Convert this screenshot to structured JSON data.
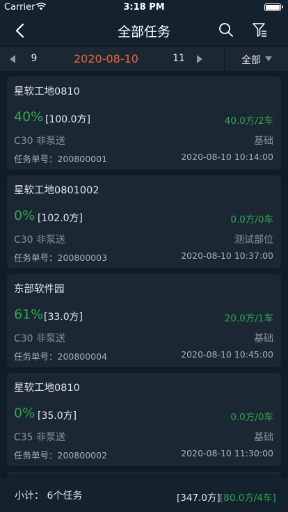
{
  "status_bar": {
    "carrier": "Carrier",
    "time": "3:18 PM"
  },
  "nav": {
    "title": "全部任务",
    "icons": [
      "back-chevron-icon",
      "search-icon",
      "filter-icon"
    ]
  },
  "date_bar": {
    "prev_day": "9",
    "current_date": "2020-08-10",
    "next_day": "11",
    "filter_label": "全部",
    "date_color": "#e8663c"
  },
  "tasks": [
    {
      "site": "星软工地0810",
      "percent": "40%",
      "volume": "[100.0方]",
      "progress": "40.0方/2车",
      "grade": "C30 非泵送",
      "part": "基础",
      "task_no": "任务单号：200800001",
      "time": "2020-08-10 10:14:00"
    },
    {
      "site": "星软工地0801002",
      "percent": "0%",
      "volume": "[102.0方]",
      "progress": "0.0方/0车",
      "grade": "C30 非泵送",
      "part": "测试部位",
      "task_no": "任务单号：200800003",
      "time": "2020-08-10 10:37:00"
    },
    {
      "site": "东部软件园",
      "percent": "61%",
      "volume": "[33.0方]",
      "progress": "20.0方/1车",
      "grade": "C30 非泵送",
      "part": "基础",
      "task_no": "任务单号：200800004",
      "time": "2020-08-10 10:45:00"
    },
    {
      "site": "星软工地0810",
      "percent": "0%",
      "volume": "[35.0方]",
      "progress": "0.0方/0车",
      "grade": "C35 非泵送",
      "part": "基础",
      "task_no": "任务单号：200800002",
      "time": "2020-08-10 11:30:00"
    }
  ],
  "footer": {
    "summary": "小计：  6个任务",
    "total_volume": "[347.0方]",
    "total_progress": "[80.0方/4车]"
  },
  "colors": {
    "background": "#0f1d27",
    "card": "#1b2833",
    "accent_green": "#2ea84a",
    "muted_text": "#8a9399"
  }
}
